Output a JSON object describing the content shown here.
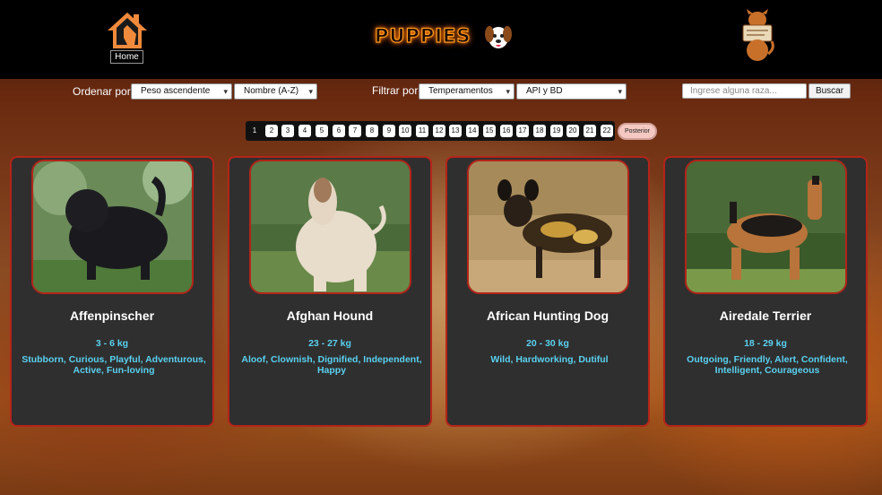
{
  "header": {
    "home_label": "Home",
    "brand": "PUPPIES",
    "home_icon": "home-icon",
    "brand_icon": "puppy-icon",
    "mascot_icon": "dog-mascot-icon",
    "brand_color": "#ff9a1e"
  },
  "controls": {
    "sort_label": "Ordenar por:",
    "sort_weight_value": "Peso ascendente",
    "sort_name_value": "Nombre (A-Z)",
    "filter_label": "Filtrar por:",
    "filter_type_value": "Temperamentos",
    "filter_source_value": "API y BD",
    "search_placeholder": "Ingrese alguna raza...",
    "search_button": "Buscar"
  },
  "pagination": {
    "pages": [
      "1",
      "2",
      "3",
      "4",
      "5",
      "6",
      "7",
      "8",
      "9",
      "10",
      "11",
      "12",
      "13",
      "14",
      "15",
      "16",
      "17",
      "18",
      "19",
      "20",
      "21",
      "22"
    ],
    "current": "1",
    "next_label": "Posterior"
  },
  "cards": [
    {
      "name": "Affenpinscher",
      "weight": "3 - 6 kg",
      "temperament": "Stubborn, Curious, Playful, Adventurous, Active, Fun-loving"
    },
    {
      "name": "Afghan Hound",
      "weight": "23 - 27 kg",
      "temperament": "Aloof, Clownish, Dignified, Independent, Happy"
    },
    {
      "name": "African Hunting Dog",
      "weight": "20 - 30 kg",
      "temperament": "Wild, Hardworking, Dutiful"
    },
    {
      "name": "Airedale Terrier",
      "weight": "18 - 29 kg",
      "temperament": "Outgoing, Friendly, Alert, Confident, Intelligent, Courageous"
    }
  ],
  "colors": {
    "card_bg": "#2f2f2f",
    "card_border": "#b42419",
    "info_text": "#5ad1f0"
  }
}
